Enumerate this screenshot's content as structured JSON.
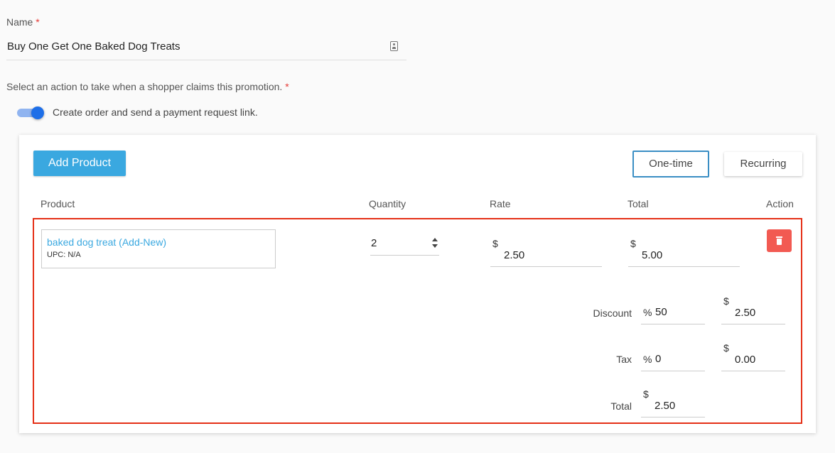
{
  "form": {
    "name_label": "Name",
    "required_mark": "*",
    "name_value": "Buy One Get One Baked Dog Treats",
    "action_prompt": "Select an action to take when a shopper claims this promotion.",
    "toggle_label": "Create order and send a payment request link.",
    "toggle_on": true
  },
  "order": {
    "add_product_label": "Add Product",
    "one_time_label": "One-time",
    "recurring_label": "Recurring",
    "columns": [
      "Product",
      "Quantity",
      "Rate",
      "Total",
      "Action"
    ],
    "line_item": {
      "product_name": "baked dog treat (Add-New)",
      "upc": "UPC: N/A",
      "quantity": "2",
      "currency": "$",
      "rate": "2.50",
      "total": "5.00"
    },
    "summary": {
      "discount_label": "Discount",
      "discount_percent_symbol": "%",
      "discount_percent": "50",
      "discount_amount": "2.50",
      "tax_label": "Tax",
      "tax_percent_symbol": "%",
      "tax_percent": "0",
      "tax_amount": "0.00",
      "total_label": "Total",
      "total_amount": "2.50"
    }
  },
  "colors": {
    "accent": "#3aa8e0",
    "toggle": "#1e6fe8",
    "highlight_border": "#e53017",
    "delete": "#f25a52"
  }
}
